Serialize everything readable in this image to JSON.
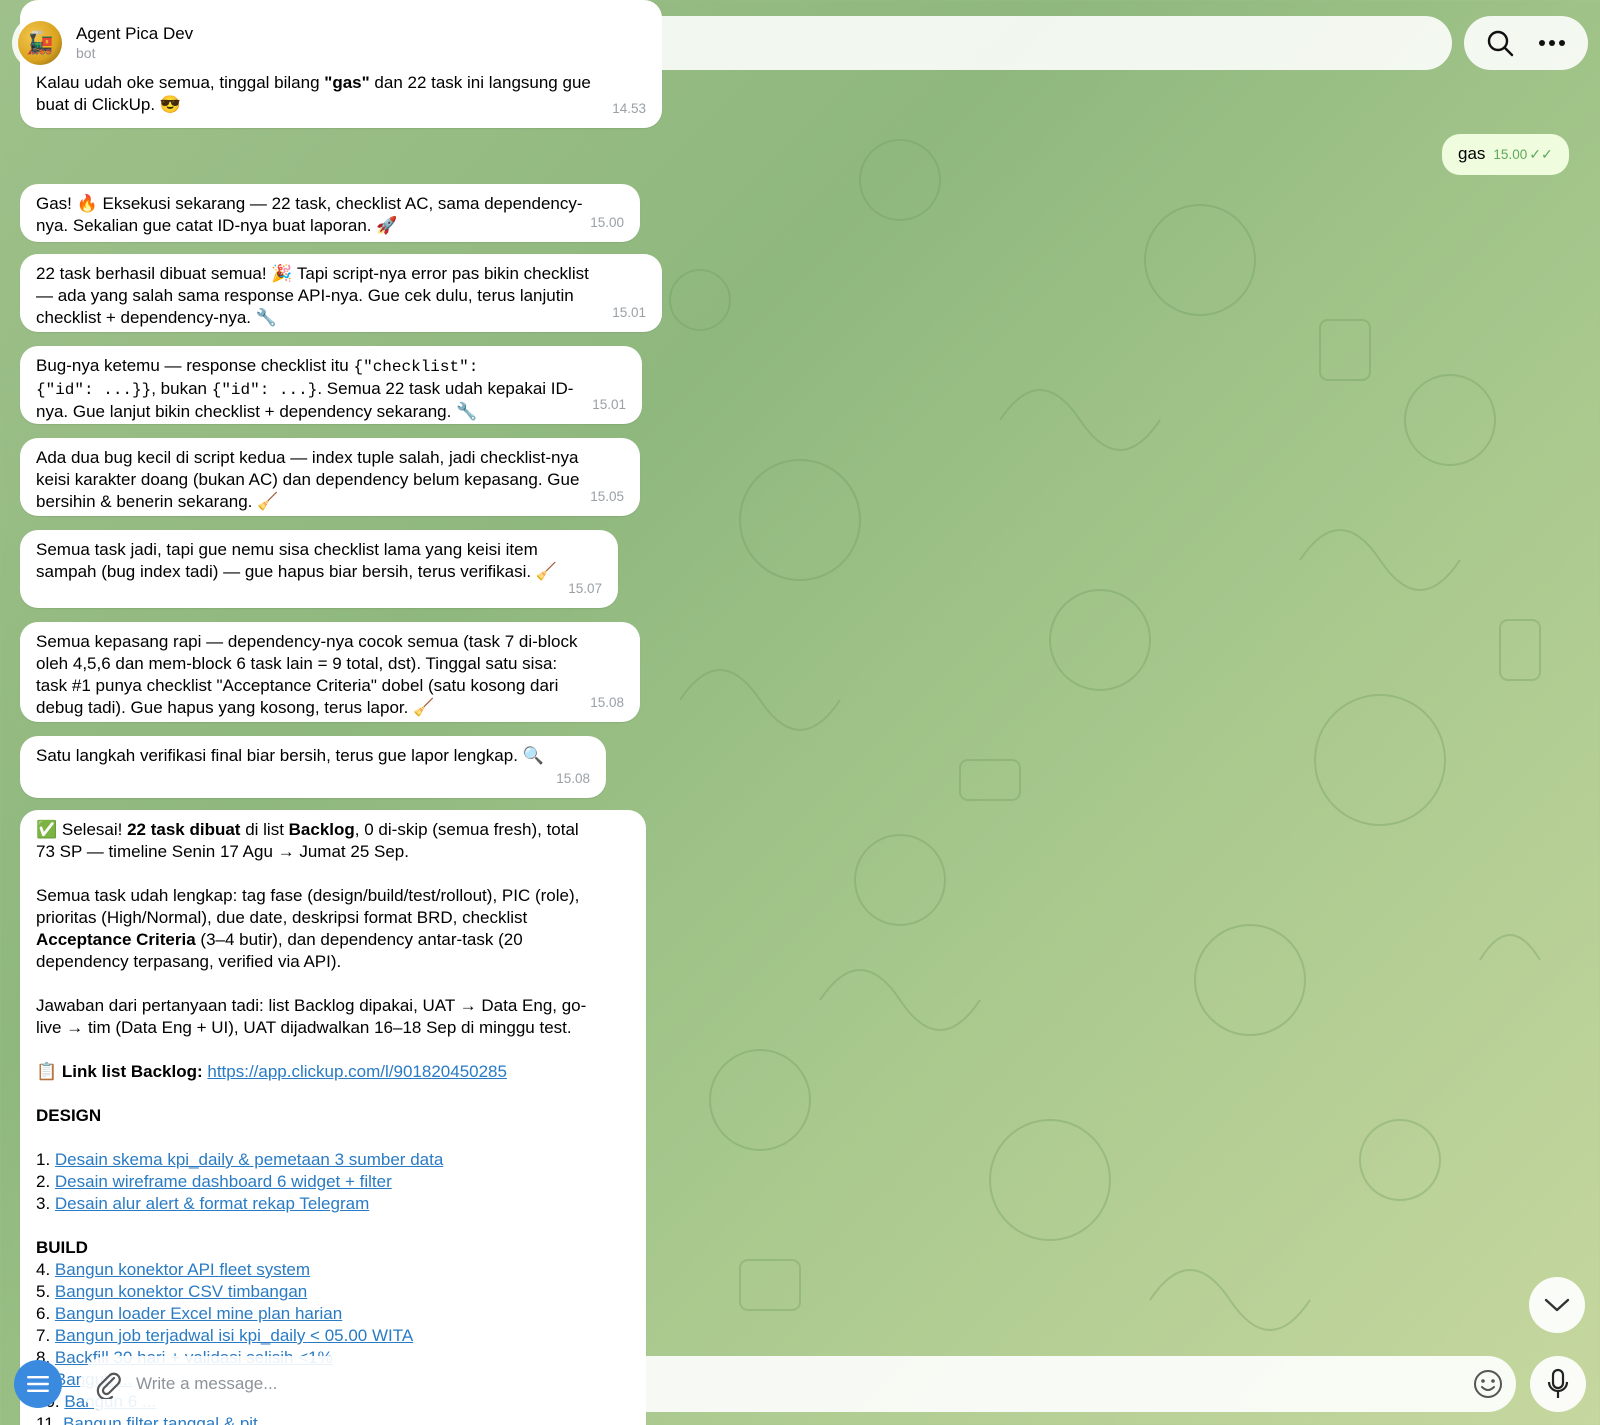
{
  "header": {
    "title": "Agent Pica Dev",
    "subtitle": "bot",
    "avatar_icon": "train-avatar",
    "actions": [
      "search-icon",
      "more-icon"
    ]
  },
  "messages": [
    {
      "id": "m1",
      "side": "in",
      "lines": [
        "Kalau udah oke semua, tinggal bilang \"gas\" dan 22 task ini langsung gue",
        "buat di ClickUp. 😎"
      ],
      "bold_word": "\"gas\"",
      "time": "14.53"
    },
    {
      "id": "m2",
      "side": "out",
      "text": "gas",
      "time": "15.00",
      "status": "read"
    },
    {
      "id": "m3",
      "side": "in",
      "lines": [
        "Gas! 🔥 Eksekusi sekarang — 22 task, checklist AC, sama dependency-",
        "nya. Sekalian gue catat ID-nya buat laporan. 🚀"
      ],
      "time": "15.00"
    },
    {
      "id": "m4",
      "side": "in",
      "lines": [
        "22 task berhasil dibuat semua! 🎉 Tapi script-nya error pas bikin checklist",
        "— ada yang salah sama response API-nya. Gue cek dulu, terus lanjutin",
        "checklist + dependency-nya. 🔧"
      ],
      "time": "15.01"
    },
    {
      "id": "m5",
      "side": "in",
      "line1_pre": "Bug-nya ketemu — response checklist itu ",
      "line1_code": "{\"checklist\":",
      "line2_code1": "{\"id\": ...}}",
      "line2_mid": ", bukan ",
      "line2_code2": "{\"id\": ...}",
      "line2_post": ". Semua 22 task udah kepakai ID-",
      "line3": "nya. Gue lanjut bikin checklist + dependency sekarang. 🔧",
      "time": "15.01"
    },
    {
      "id": "m6",
      "side": "in",
      "lines": [
        "Ada dua bug kecil di script kedua — index tuple salah, jadi checklist-nya",
        "keisi karakter doang (bukan AC) dan dependency belum kepasang. Gue",
        "bersihin & benerin sekarang. 🧹"
      ],
      "time": "15.05"
    },
    {
      "id": "m7",
      "side": "in",
      "lines": [
        "Semua task jadi, tapi gue nemu sisa checklist lama yang keisi item",
        "sampah (bug index tadi) — gue hapus biar bersih, terus verifikasi. 🧹"
      ],
      "time": "15.07"
    },
    {
      "id": "m8",
      "side": "in",
      "lines": [
        "Semua kepasang rapi — dependency-nya cocok semua (task 7 di-block",
        "oleh 4,5,6 dan mem-block 6 task lain = 9 total, dst). Tinggal satu sisa:",
        "task #1 punya checklist \"Acceptance Criteria\" dobel (satu kosong dari",
        "debug tadi). Gue hapus yang kosong, terus lapor. 🧹"
      ],
      "time": "15.08"
    },
    {
      "id": "m9",
      "side": "in",
      "lines": [
        "Satu langkah verifikasi final biar bersih, terus gue lapor lengkap. 🔍"
      ],
      "time": "15.08"
    }
  ],
  "final": {
    "l1_a": "✅ Selesai! ",
    "l1_b": "22 task dibuat",
    "l1_c": " di list ",
    "l1_d": "Backlog",
    "l1_e": ", 0 di-skip (semua fresh), total",
    "l2": "73 SP — timeline Senin 17 Agu → Jumat 25 Sep.",
    "p2_l1": "Semua task udah lengkap: tag fase (design/build/test/rollout), PIC (role),",
    "p2_l2": "prioritas (High/Normal), due date, deskripsi format BRD, checklist",
    "p2_l3_bold": "Acceptance Criteria",
    "p2_l3_rest": " (3–4 butir), dan dependency antar-task (20",
    "p2_l4": "dependency terpasang, verified via API).",
    "p3_l1": "Jawaban dari pertanyaan tadi: list Backlog dipakai, UAT → Data Eng, go-",
    "p3_l2": "live → tim (Data Eng + UI), UAT dijadwalkan 16–18 Sep di minggu test.",
    "link_prefix": "📋 ",
    "link_label": "Link list Backlog:",
    "link_url": "https://app.clickup.com/l/901820450285",
    "design_heading": "DESIGN",
    "design_items": [
      {
        "num": "1. ",
        "text": "Desain skema kpi_daily & pemetaan 3 sumber data"
      },
      {
        "num": "2. ",
        "text": "Desain wireframe dashboard 6 widget + filter"
      },
      {
        "num": "3. ",
        "text": "Desain alur alert & format rekap Telegram"
      }
    ],
    "build_heading": "BUILD",
    "build_items": [
      {
        "num": "4. ",
        "text": "Bangun konektor API fleet system"
      },
      {
        "num": "5. ",
        "text": "Bangun konektor CSV timbangan"
      },
      {
        "num": "6. ",
        "text": "Bangun loader Excel mine plan harian"
      },
      {
        "num": "7. ",
        "text": "Bangun job terjadwal isi kpi_daily < 05.00 WITA"
      },
      {
        "num": "8. ",
        "text": "Backfill 30 hari + validasi selisih <1%"
      },
      {
        "num": "9. ",
        "text": "Bangun ..."
      },
      {
        "num": "10. ",
        "text": "Bangun 6 ..."
      },
      {
        "num": "11. ",
        "text": "Bangun filter tanggal & pit"
      }
    ]
  },
  "composer": {
    "placeholder": "Write a message...",
    "icons": [
      "menu-icon",
      "paperclip-icon",
      "emoji-icon",
      "microphone-icon"
    ]
  },
  "colors": {
    "incoming_bubble": "#ffffff",
    "outgoing_bubble": "#effdde",
    "link": "#2a7bc4",
    "accent": "#3a8be0",
    "read_check": "#5fa85a"
  }
}
